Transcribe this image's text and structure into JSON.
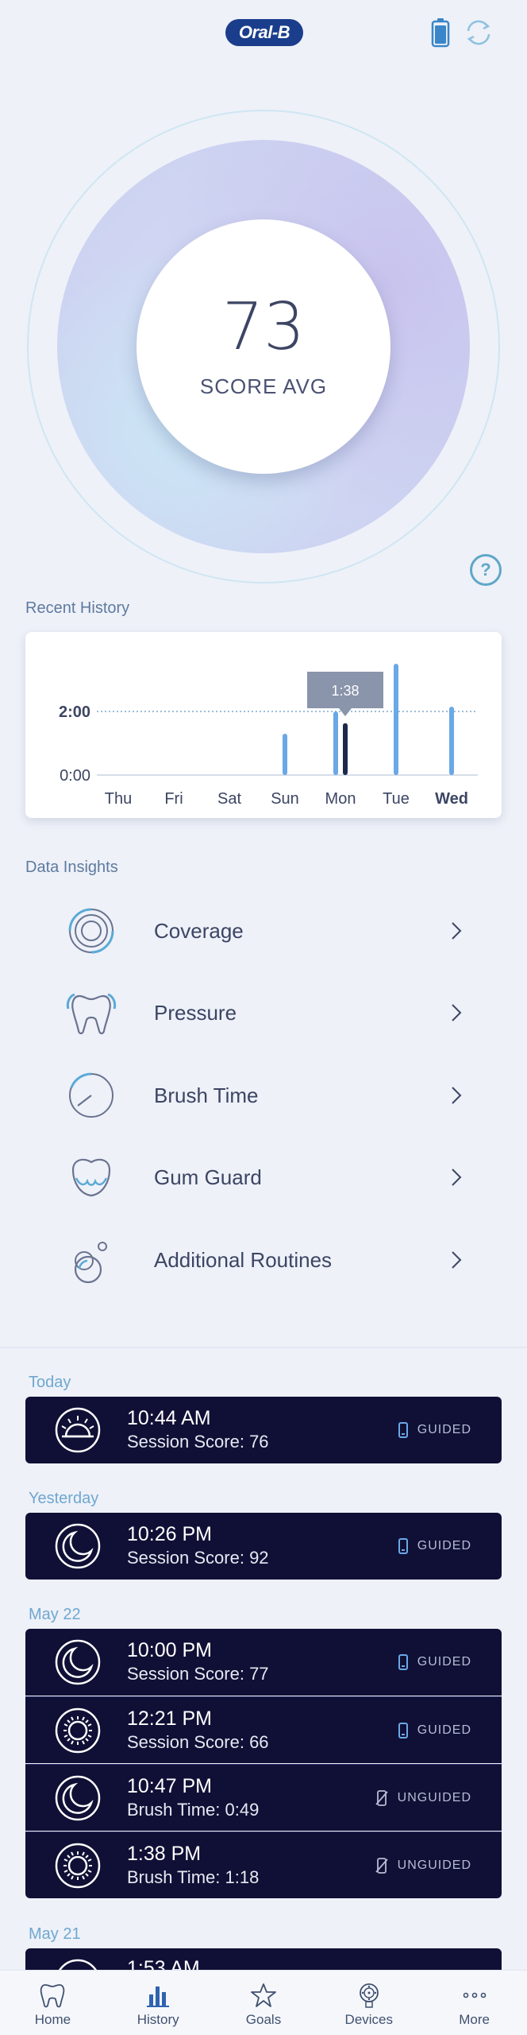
{
  "header": {
    "logo_text": "Oral-B",
    "battery_icon": "battery-icon",
    "sync_icon": "sync-icon"
  },
  "score": {
    "value": "73",
    "label": "SCORE AVG",
    "help_text": "?"
  },
  "recent_history": {
    "label": "Recent History",
    "chart_data": {
      "type": "bar",
      "categories": [
        "Thu",
        "Fri",
        "Sat",
        "Sun",
        "Mon",
        "Tue",
        "Wed"
      ],
      "y_ticks": [
        "0:00",
        "2:00"
      ],
      "reference_line": "2:00",
      "tooltip": "1:38",
      "selected_category": "Mon",
      "today_category": "Wed",
      "series": [
        {
          "values": [
            [],
            [],
            [],
            [
              1.3
            ],
            [
              2.0,
              1.63
            ],
            [
              3.5
            ],
            [
              2.15
            ]
          ]
        }
      ],
      "ylim": [
        0,
        4
      ]
    }
  },
  "insights": {
    "label": "Data Insights",
    "items": [
      {
        "label": "Coverage",
        "icon": "coverage-icon"
      },
      {
        "label": "Pressure",
        "icon": "tooth-icon"
      },
      {
        "label": "Brush Time",
        "icon": "timer-icon"
      },
      {
        "label": "Gum Guard",
        "icon": "gum-guard-icon"
      },
      {
        "label": "Additional Routines",
        "icon": "bubbles-icon"
      }
    ]
  },
  "sessions": {
    "groups": [
      {
        "day": "Today",
        "items": [
          {
            "time": "10:44 AM",
            "detail": "Session Score: 76",
            "mode": "GUIDED",
            "icon": "sunrise-icon"
          }
        ]
      },
      {
        "day": "Yesterday",
        "items": [
          {
            "time": "10:26 PM",
            "detail": "Session Score: 92",
            "mode": "GUIDED",
            "icon": "moon-icon"
          }
        ]
      },
      {
        "day": "May 22",
        "items": [
          {
            "time": "10:00 PM",
            "detail": "Session Score: 77",
            "mode": "GUIDED",
            "icon": "moon-icon"
          },
          {
            "time": "12:21 PM",
            "detail": "Session Score: 66",
            "mode": "GUIDED",
            "icon": "sun-icon"
          },
          {
            "time": "10:47 PM",
            "detail": "Brush Time: 0:49",
            "mode": "UNGUIDED",
            "icon": "moon-icon"
          },
          {
            "time": "1:38 PM",
            "detail": "Brush Time: 1:18",
            "mode": "UNGUIDED",
            "icon": "sun-icon"
          }
        ]
      },
      {
        "day": "May 21",
        "items": [
          {
            "time": "1:53 AM",
            "detail": "",
            "mode": "",
            "icon": "moon-icon"
          }
        ]
      }
    ]
  },
  "nav": {
    "items": [
      {
        "label": "Home",
        "icon": "home-tooth-icon"
      },
      {
        "label": "History",
        "icon": "bar-chart-icon"
      },
      {
        "label": "Goals",
        "icon": "star-icon"
      },
      {
        "label": "Devices",
        "icon": "brush-head-icon"
      },
      {
        "label": "More",
        "icon": "more-dots-icon"
      }
    ]
  },
  "colors": {
    "background": "#eef1f8",
    "session_bg": "#101036",
    "accent_blue": "#6fa7d0",
    "bar_blue": "#6aa8e6",
    "bar_selected": "#1c2a4a",
    "logo_blue": "#1a3e8c"
  }
}
